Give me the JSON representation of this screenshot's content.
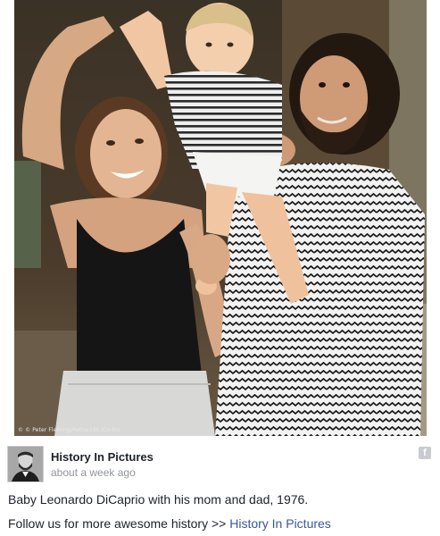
{
  "photo": {
    "credit": "© © Peter Fleming/Retna Ltd./Corbis",
    "alt_subject": "family-photo"
  },
  "post": {
    "page_name": "History In Pictures",
    "timestamp": "about a week ago",
    "caption": "Baby Leonardo DiCaprio with his mom and dad, 1976.",
    "follow_text": "Follow us for more awesome history >> ",
    "follow_link": "History In Pictures"
  },
  "icons": {
    "facebook": "f",
    "avatar": "profile-avatar"
  },
  "colors": {
    "link": "#365899",
    "meta": "#90949c",
    "text": "#1d2129",
    "fb_icon": "#c8ccd2"
  }
}
